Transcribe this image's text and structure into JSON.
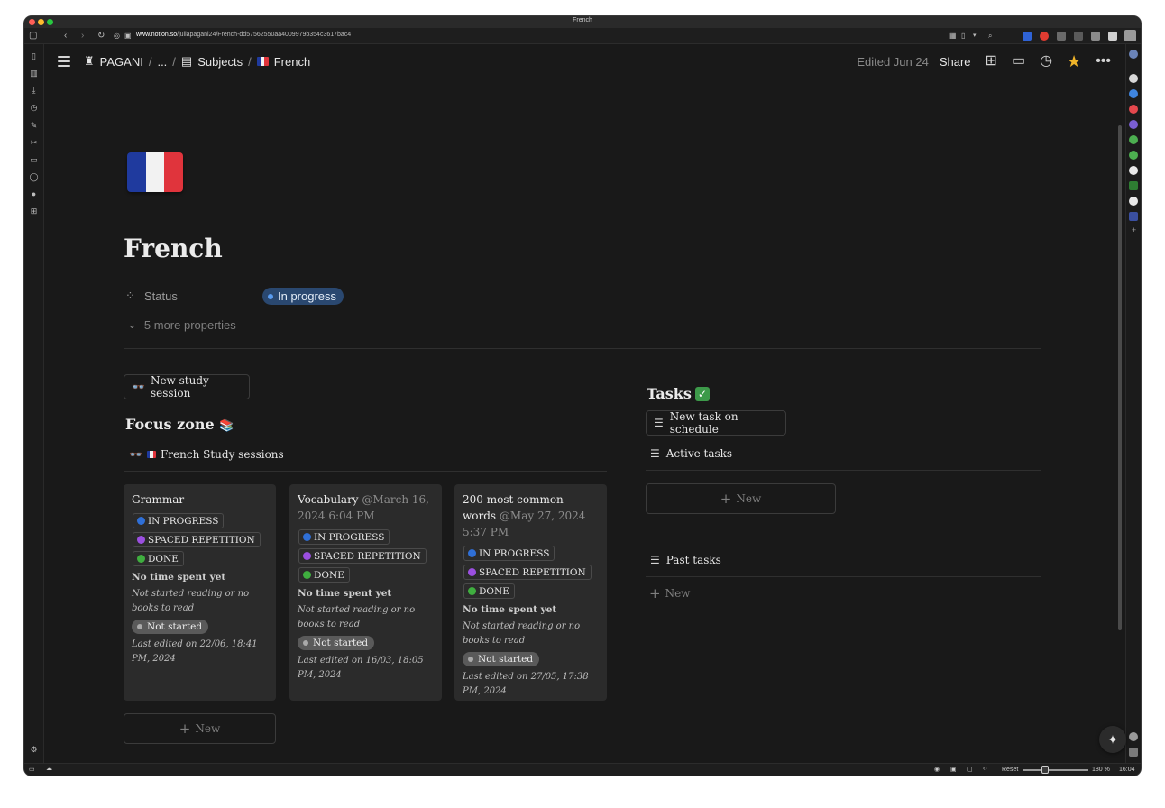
{
  "window": {
    "title": "French"
  },
  "browser": {
    "url_host": "www.notion.so",
    "url_path": "/juliapagani24/French-dd57562550aa4009979b354c3617bac4",
    "status": {
      "reset": "Reset",
      "zoom": "180 %",
      "time": "16:04"
    }
  },
  "breadcrumb": {
    "workspace": "PAGANI",
    "ellipsis": "...",
    "section": "Subjects",
    "page": "French",
    "separator": "/"
  },
  "topbar": {
    "edited": "Edited Jun 24",
    "share": "Share"
  },
  "page": {
    "title": "French",
    "status_label": "Status",
    "status_value": "In progress",
    "more_properties": "5 more properties"
  },
  "focus": {
    "new_session_button": "New study session",
    "title": "Focus zone",
    "database_title": "French Study sessions",
    "new_button": "New",
    "cards": [
      {
        "title": "Grammar",
        "mention": "",
        "tag_in_progress": "IN PROGRESS",
        "tag_spaced": "SPACED REPETITION",
        "tag_done": "DONE",
        "time": "No time spent yet",
        "reading": "Not started reading or no books to read",
        "status": "Not started",
        "last_edited": "Last edited on 22/06, 18:41 PM, 2024"
      },
      {
        "title": "Vocabulary",
        "mention": "@March 16, 2024 6:04 PM",
        "tag_in_progress": "IN PROGRESS",
        "tag_spaced": "SPACED REPETITION",
        "tag_done": "DONE",
        "time": "No time spent yet",
        "reading": "Not started reading or no books to read",
        "status": "Not started",
        "last_edited": "Last edited on 16/03, 18:05 PM, 2024"
      },
      {
        "title": "200 most common words",
        "mention": "@May 27, 2024 5:37 PM",
        "tag_in_progress": "IN PROGRESS",
        "tag_spaced": "SPACED REPETITION",
        "tag_done": "DONE",
        "time": "No time spent yet",
        "reading": "Not started reading or no books to read",
        "status": "Not started",
        "last_edited": "Last edited on 27/05, 17:38 PM, 2024"
      }
    ]
  },
  "tasks": {
    "title": "Tasks",
    "new_task_button": "New task on schedule",
    "active_title": "Active tasks",
    "active_new": "New",
    "past_title": "Past tasks",
    "past_new": "New"
  },
  "colors": {
    "background": "#191919",
    "card": "#2b2b2b",
    "status_badge": "#2a4870",
    "tag_blue": "#2f6fd6",
    "tag_purple": "#9b4fe0",
    "tag_green": "#3fae3f",
    "flag_blue": "#1f3a9e",
    "flag_white": "#f2f2f2",
    "flag_red": "#e0343c",
    "star": "#f0b429"
  },
  "icons": [
    "hamburger-icon",
    "castle-icon",
    "archive-icon",
    "flag-icon",
    "loader-icon",
    "chevron-down-icon",
    "glasses-icon",
    "books-icon",
    "checkbox-icon",
    "checklist-icon",
    "plus-icon",
    "layout-icon",
    "comment-icon",
    "clock-icon",
    "star-icon",
    "more-icon",
    "sparkle-icon"
  ]
}
